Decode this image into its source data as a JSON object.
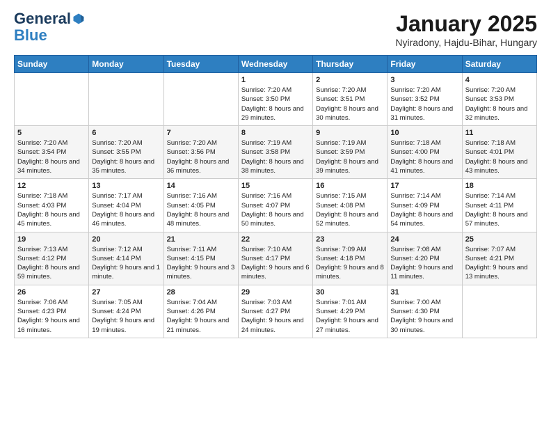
{
  "logo": {
    "general": "General",
    "blue": "Blue"
  },
  "header": {
    "title": "January 2025",
    "subtitle": "Nyiradony, Hajdu-Bihar, Hungary"
  },
  "weekdays": [
    "Sunday",
    "Monday",
    "Tuesday",
    "Wednesday",
    "Thursday",
    "Friday",
    "Saturday"
  ],
  "weeks": [
    [
      {
        "day": "",
        "info": ""
      },
      {
        "day": "",
        "info": ""
      },
      {
        "day": "",
        "info": ""
      },
      {
        "day": "1",
        "info": "Sunrise: 7:20 AM\nSunset: 3:50 PM\nDaylight: 8 hours and 29 minutes."
      },
      {
        "day": "2",
        "info": "Sunrise: 7:20 AM\nSunset: 3:51 PM\nDaylight: 8 hours and 30 minutes."
      },
      {
        "day": "3",
        "info": "Sunrise: 7:20 AM\nSunset: 3:52 PM\nDaylight: 8 hours and 31 minutes."
      },
      {
        "day": "4",
        "info": "Sunrise: 7:20 AM\nSunset: 3:53 PM\nDaylight: 8 hours and 32 minutes."
      }
    ],
    [
      {
        "day": "5",
        "info": "Sunrise: 7:20 AM\nSunset: 3:54 PM\nDaylight: 8 hours and 34 minutes."
      },
      {
        "day": "6",
        "info": "Sunrise: 7:20 AM\nSunset: 3:55 PM\nDaylight: 8 hours and 35 minutes."
      },
      {
        "day": "7",
        "info": "Sunrise: 7:20 AM\nSunset: 3:56 PM\nDaylight: 8 hours and 36 minutes."
      },
      {
        "day": "8",
        "info": "Sunrise: 7:19 AM\nSunset: 3:58 PM\nDaylight: 8 hours and 38 minutes."
      },
      {
        "day": "9",
        "info": "Sunrise: 7:19 AM\nSunset: 3:59 PM\nDaylight: 8 hours and 39 minutes."
      },
      {
        "day": "10",
        "info": "Sunrise: 7:18 AM\nSunset: 4:00 PM\nDaylight: 8 hours and 41 minutes."
      },
      {
        "day": "11",
        "info": "Sunrise: 7:18 AM\nSunset: 4:01 PM\nDaylight: 8 hours and 43 minutes."
      }
    ],
    [
      {
        "day": "12",
        "info": "Sunrise: 7:18 AM\nSunset: 4:03 PM\nDaylight: 8 hours and 45 minutes."
      },
      {
        "day": "13",
        "info": "Sunrise: 7:17 AM\nSunset: 4:04 PM\nDaylight: 8 hours and 46 minutes."
      },
      {
        "day": "14",
        "info": "Sunrise: 7:16 AM\nSunset: 4:05 PM\nDaylight: 8 hours and 48 minutes."
      },
      {
        "day": "15",
        "info": "Sunrise: 7:16 AM\nSunset: 4:07 PM\nDaylight: 8 hours and 50 minutes."
      },
      {
        "day": "16",
        "info": "Sunrise: 7:15 AM\nSunset: 4:08 PM\nDaylight: 8 hours and 52 minutes."
      },
      {
        "day": "17",
        "info": "Sunrise: 7:14 AM\nSunset: 4:09 PM\nDaylight: 8 hours and 54 minutes."
      },
      {
        "day": "18",
        "info": "Sunrise: 7:14 AM\nSunset: 4:11 PM\nDaylight: 8 hours and 57 minutes."
      }
    ],
    [
      {
        "day": "19",
        "info": "Sunrise: 7:13 AM\nSunset: 4:12 PM\nDaylight: 8 hours and 59 minutes."
      },
      {
        "day": "20",
        "info": "Sunrise: 7:12 AM\nSunset: 4:14 PM\nDaylight: 9 hours and 1 minute."
      },
      {
        "day": "21",
        "info": "Sunrise: 7:11 AM\nSunset: 4:15 PM\nDaylight: 9 hours and 3 minutes."
      },
      {
        "day": "22",
        "info": "Sunrise: 7:10 AM\nSunset: 4:17 PM\nDaylight: 9 hours and 6 minutes."
      },
      {
        "day": "23",
        "info": "Sunrise: 7:09 AM\nSunset: 4:18 PM\nDaylight: 9 hours and 8 minutes."
      },
      {
        "day": "24",
        "info": "Sunrise: 7:08 AM\nSunset: 4:20 PM\nDaylight: 9 hours and 11 minutes."
      },
      {
        "day": "25",
        "info": "Sunrise: 7:07 AM\nSunset: 4:21 PM\nDaylight: 9 hours and 13 minutes."
      }
    ],
    [
      {
        "day": "26",
        "info": "Sunrise: 7:06 AM\nSunset: 4:23 PM\nDaylight: 9 hours and 16 minutes."
      },
      {
        "day": "27",
        "info": "Sunrise: 7:05 AM\nSunset: 4:24 PM\nDaylight: 9 hours and 19 minutes."
      },
      {
        "day": "28",
        "info": "Sunrise: 7:04 AM\nSunset: 4:26 PM\nDaylight: 9 hours and 21 minutes."
      },
      {
        "day": "29",
        "info": "Sunrise: 7:03 AM\nSunset: 4:27 PM\nDaylight: 9 hours and 24 minutes."
      },
      {
        "day": "30",
        "info": "Sunrise: 7:01 AM\nSunset: 4:29 PM\nDaylight: 9 hours and 27 minutes."
      },
      {
        "day": "31",
        "info": "Sunrise: 7:00 AM\nSunset: 4:30 PM\nDaylight: 9 hours and 30 minutes."
      },
      {
        "day": "",
        "info": ""
      }
    ]
  ]
}
